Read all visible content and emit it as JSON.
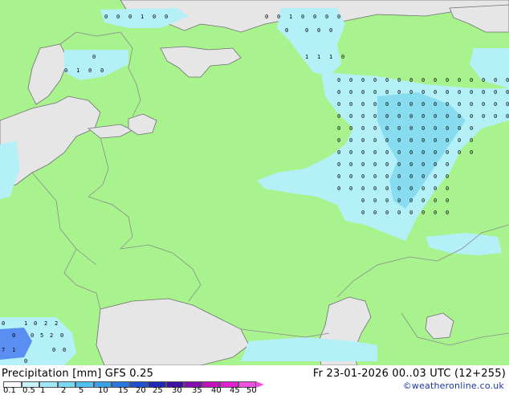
{
  "map": {
    "land_color": "#a9f38f",
    "sea_color": "#e6e6e6",
    "precip_light_color": "#b4f0f8",
    "precip_medium_color": "#88dcf0",
    "precip_heavy_color": "#5a8ef0",
    "border_color": "#8a8a8a",
    "coast_color": "#6f6f6f",
    "grid_numbers_top": [
      "0",
      "0",
      "0",
      "1",
      "0",
      "0",
      "0",
      "0",
      "1",
      "0",
      "0",
      "0",
      "0",
      "0",
      "0",
      "0",
      "0"
    ],
    "grid_numbers_north": [
      "0",
      "1",
      "0",
      "0",
      "0",
      "1",
      "1",
      "1",
      "0"
    ],
    "grid_numbers_sw": [
      "0",
      "7",
      "1",
      "0",
      "0",
      "5",
      "2",
      "0",
      "1",
      "0",
      "2",
      "2",
      "0",
      "0",
      "0"
    ]
  },
  "footer": {
    "title_left": "Precipitation [mm]  GFS 0.25",
    "title_right": "Fr 23-01-2026 00..03 UTC (12+255)",
    "credit": "©weatheronline.co.uk",
    "scale_ticks": [
      "0.1",
      "0.5",
      "1",
      "2",
      "5",
      "10",
      "15",
      "20",
      "25",
      "30",
      "35",
      "40",
      "45",
      "50"
    ],
    "scale_colors": [
      "#fafafa",
      "#c8f0f8",
      "#a0e8f8",
      "#78d8f0",
      "#50c0f0",
      "#3ca0e8",
      "#2878e0",
      "#1e50d0",
      "#1e28b4",
      "#4010a0",
      "#8010b0",
      "#c010c0",
      "#e020d0",
      "#f050e0"
    ]
  }
}
